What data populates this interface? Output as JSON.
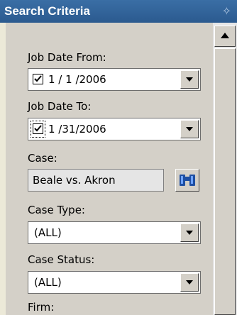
{
  "panel": {
    "title": "Search Criteria",
    "pin_icon": "pin-icon"
  },
  "fields": {
    "job_date_from": {
      "label": "Job Date From:",
      "value": "1 / 1 /2006",
      "checked": true
    },
    "job_date_to": {
      "label": "Job Date To:",
      "value": "1 /31/2006",
      "checked": true
    },
    "case": {
      "label": "Case:",
      "value": "Beale vs. Akron",
      "button_icon": "binoculars-icon"
    },
    "case_type": {
      "label": "Case Type:",
      "value": "(ALL)"
    },
    "case_status": {
      "label": "Case Status:",
      "value": "(ALL)"
    },
    "firm": {
      "label": "Firm:"
    }
  },
  "colors": {
    "titlebar": "#3a6ea5",
    "panel": "#d4d0c8",
    "field_bg": "#ffffff",
    "case_bg": "#e5e5e5"
  }
}
